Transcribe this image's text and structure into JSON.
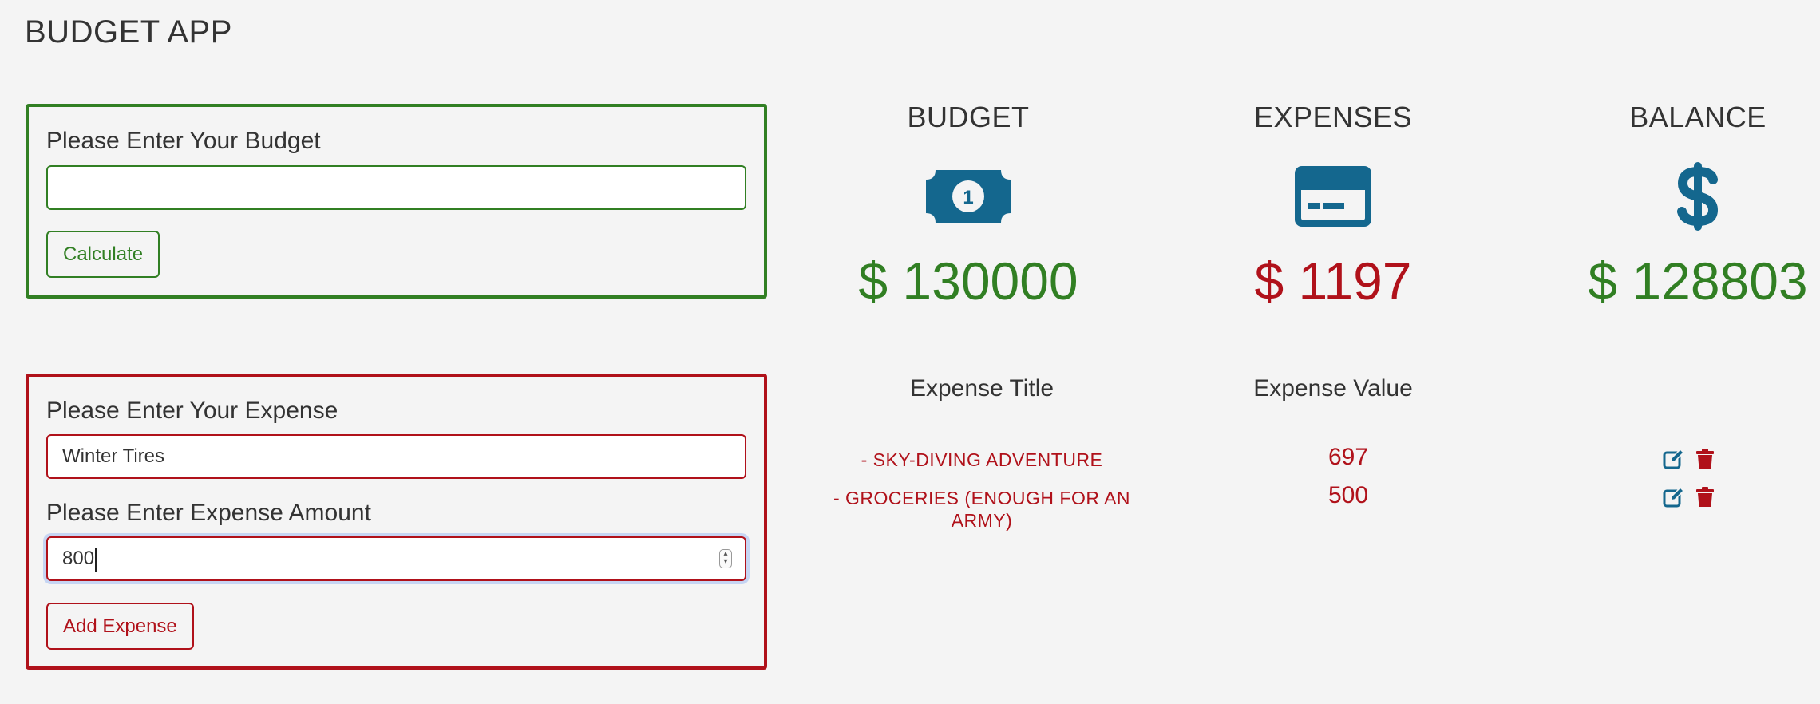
{
  "app": {
    "title": "BUDGET APP"
  },
  "budget_form": {
    "label": "Please Enter Your Budget",
    "input_value": "",
    "button": "Calculate"
  },
  "expense_form": {
    "title_label": "Please Enter Your Expense",
    "title_value": "Winter Tires",
    "amount_label": "Please Enter Expense Amount",
    "amount_value": "800",
    "button": "Add Expense"
  },
  "summary": {
    "budget": {
      "label": "BUDGET",
      "amount": "$ 130000",
      "icon": "money-bill-icon"
    },
    "expenses": {
      "label": "EXPENSES",
      "amount": "$ 1197",
      "icon": "credit-card-icon"
    },
    "balance": {
      "label": "BALANCE",
      "amount": "$ 128803",
      "icon": "dollar-sign-icon"
    }
  },
  "expense_list": {
    "headers": {
      "title": "Expense Title",
      "value": "Expense Value"
    },
    "items": [
      {
        "title": "- SKY-DIVING ADVENTURE",
        "value": "697"
      },
      {
        "title": "- GROCERIES (ENOUGH FOR AN ARMY)",
        "value": "500"
      }
    ]
  },
  "colors": {
    "green": "#317f23",
    "red": "#b0111a",
    "icon_blue": "#14678e",
    "background": "#f4f4f4"
  }
}
